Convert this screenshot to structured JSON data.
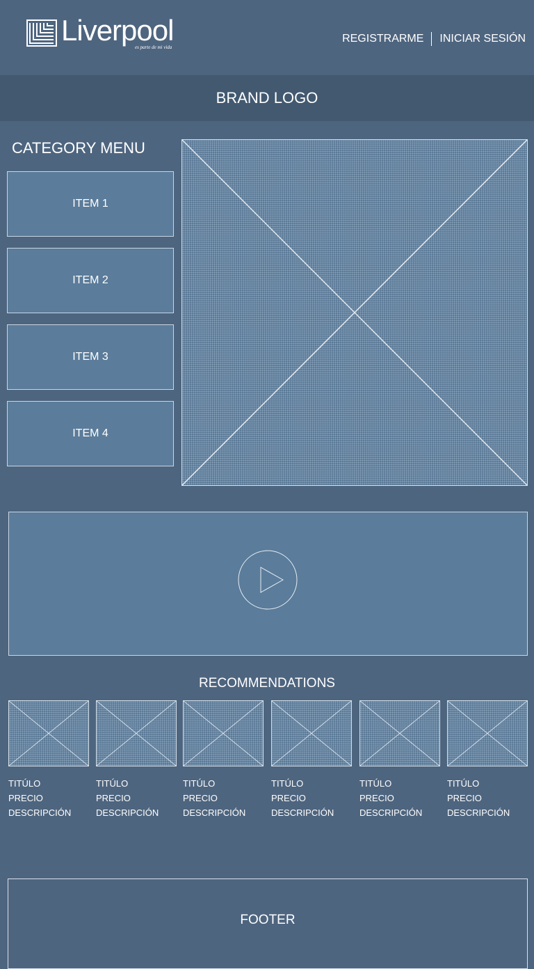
{
  "header": {
    "logo_text": "Liverpool",
    "logo_tagline": "es parte de mi vida",
    "nav": {
      "register": "REGISTRARME",
      "login": "INICIAR SESIÓN"
    }
  },
  "brand_bar": {
    "label": "BRAND LOGO"
  },
  "category_menu": {
    "title": "CATEGORY MENU",
    "items": [
      {
        "label": "ITEM 1"
      },
      {
        "label": "ITEM 2"
      },
      {
        "label": "ITEM 3"
      },
      {
        "label": "ITEM 4"
      }
    ]
  },
  "hero": {
    "icon": "image-placeholder-icon"
  },
  "video": {
    "icon": "play-icon"
  },
  "recommendations": {
    "title": "RECOMMENDATIONS",
    "items": [
      {
        "title": "TITÚLO",
        "price": "PRECIO",
        "description": "DESCRIPCIÓN"
      },
      {
        "title": "TITÚLO",
        "price": "PRECIO",
        "description": "DESCRIPCIÓN"
      },
      {
        "title": "TITÚLO",
        "price": "PRECIO",
        "description": "DESCRIPCIÓN"
      },
      {
        "title": "TITÚLO",
        "price": "PRECIO",
        "description": "DESCRIPCIÓN"
      },
      {
        "title": "TITÚLO",
        "price": "PRECIO",
        "description": "DESCRIPCIÓN"
      },
      {
        "title": "TITÚLO",
        "price": "PRECIO",
        "description": "DESCRIPCIÓN"
      }
    ]
  },
  "footer": {
    "label": "FOOTER"
  },
  "colors": {
    "background": "#4e657f",
    "brand_bar": "#425970",
    "panel": "#5b7c9a",
    "line": "#d8e2ec"
  }
}
